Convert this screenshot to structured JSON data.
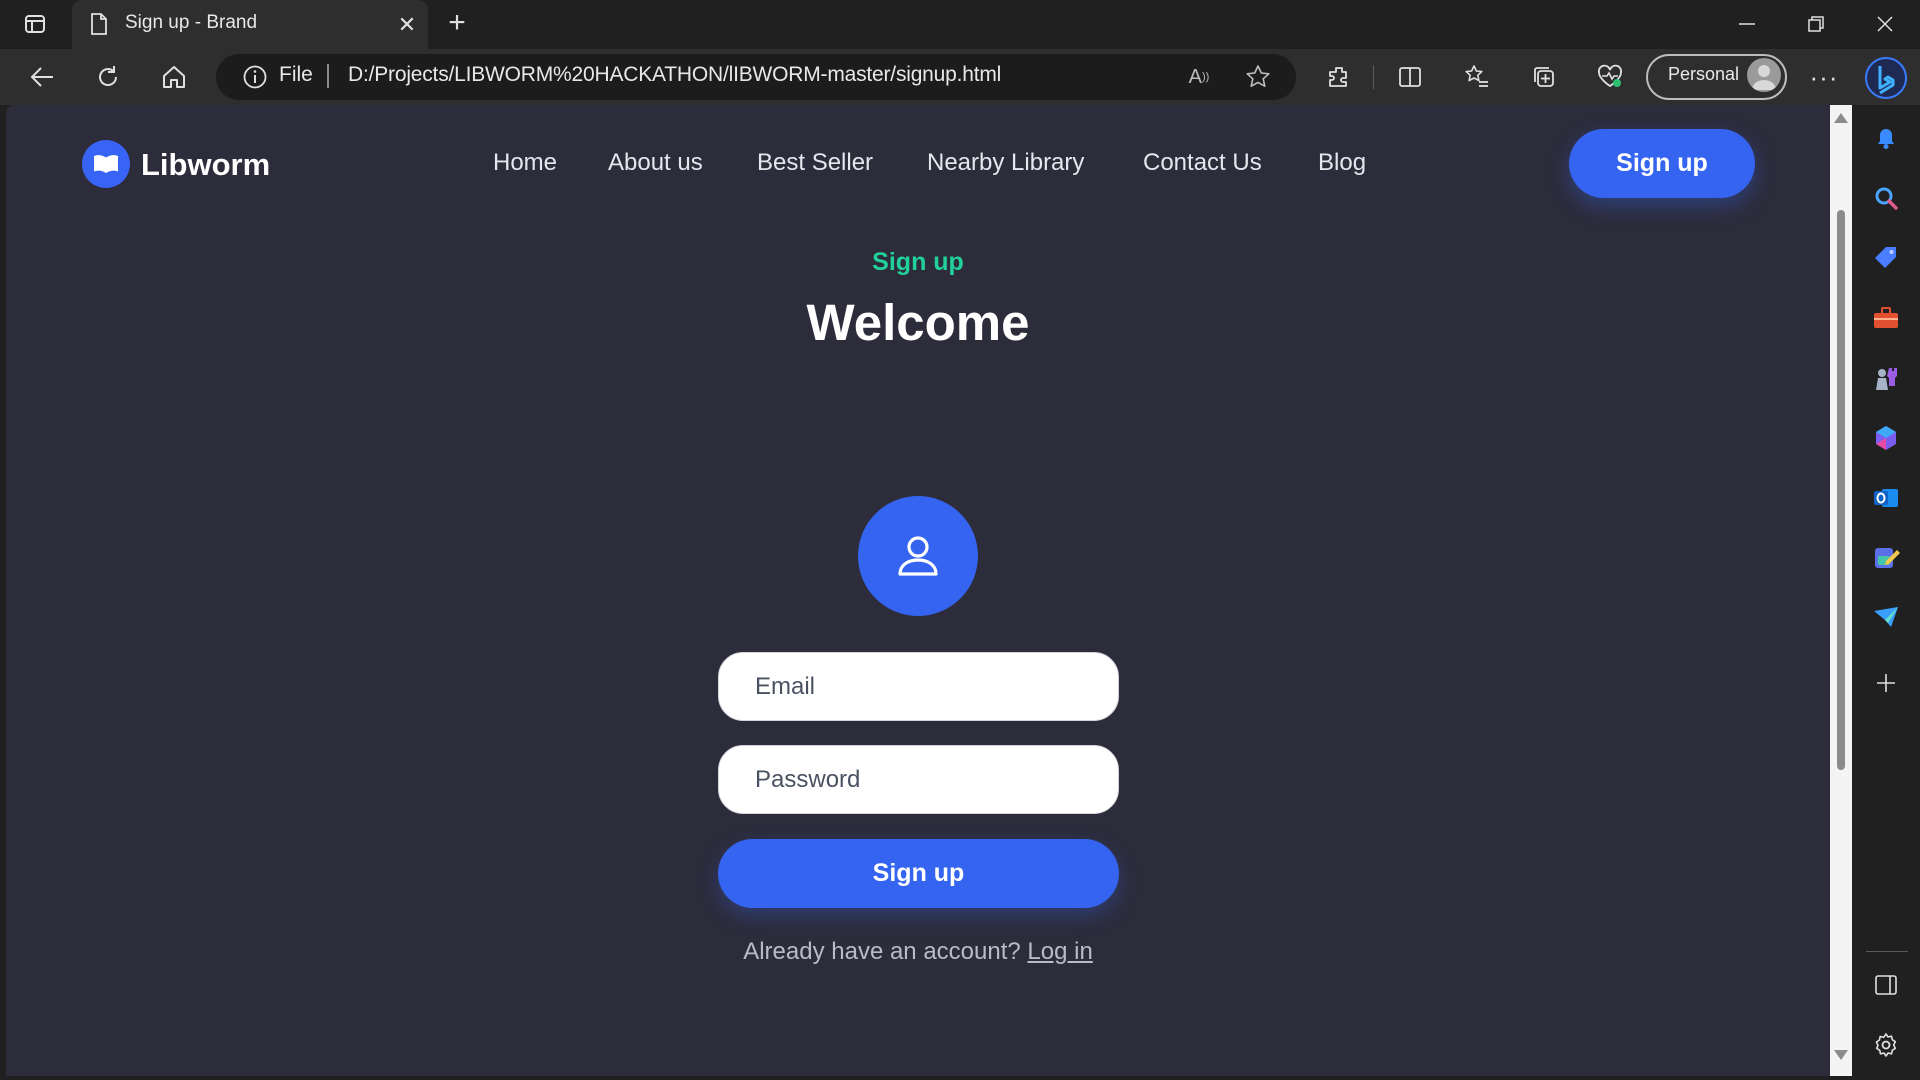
{
  "browser": {
    "tab_title": "Sign up - Brand",
    "address_scheme_label": "File",
    "url": "D:/Projects/LIBWORM%20HACKATHON/lIBWORM-master/signup.html",
    "profile_label": "Personal",
    "icons": [
      "tab-actions-icon",
      "page-icon",
      "close-icon",
      "new-tab-icon",
      "minimize-icon",
      "restore-icon",
      "window-close-icon",
      "back-icon",
      "refresh-icon",
      "home-icon",
      "info-icon",
      "read-aloud-icon",
      "favorite-star-icon",
      "extensions-icon",
      "split-screen-icon",
      "favorites-icon",
      "collections-icon",
      "browser-essentials-icon",
      "more-icon",
      "copilot-icon"
    ]
  },
  "sidebar": {
    "icons": [
      "bell-icon",
      "search-icon",
      "shopping-tag-icon",
      "toolbox-icon",
      "games-icon",
      "microsoft-365-icon",
      "outlook-icon",
      "designer-icon",
      "send-icon",
      "add-icon",
      "sidebar-panel-icon",
      "settings-icon"
    ]
  },
  "page": {
    "brand": "Libworm",
    "nav": [
      "Home",
      "About us",
      "Best Seller",
      "Nearby Library",
      "Contact Us",
      "Blog"
    ],
    "header_button": "Sign up",
    "eyebrow": "Sign up",
    "headline": "Welcome",
    "form": {
      "email_placeholder": "Email",
      "password_placeholder": "Password",
      "submit_label": "Sign up",
      "footer_text": "Already have an account?",
      "login_link": "Log in"
    },
    "colors": {
      "background": "#2c2c3b",
      "accent": "#3564f0",
      "eyebrow": "#22d19a"
    }
  }
}
